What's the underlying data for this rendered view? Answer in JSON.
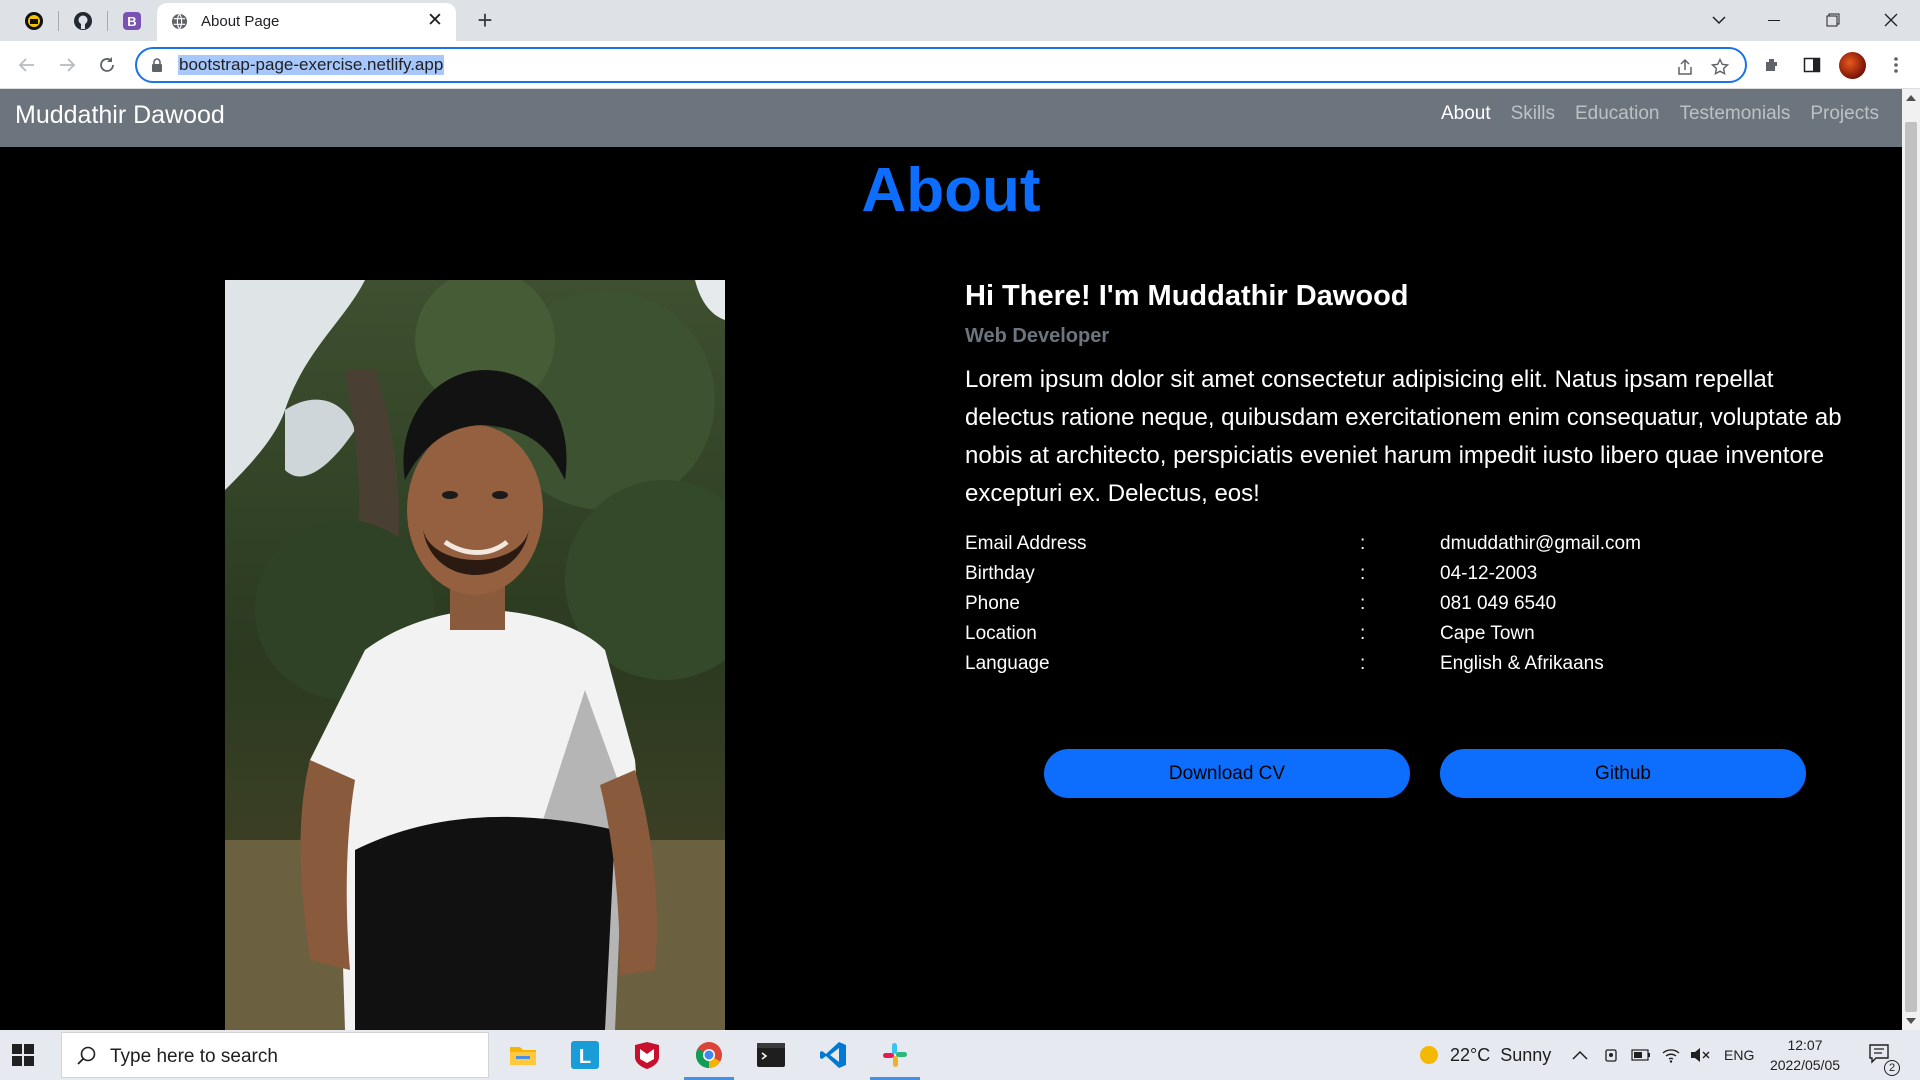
{
  "browser": {
    "tab_title": "About Page",
    "url": "bootstrap-page-exercise.netlify.app",
    "pinned_tabs": [
      "pinned-tab-icon",
      "github-icon",
      "bootstrap-icon"
    ]
  },
  "navbar": {
    "brand": "Muddathir Dawood",
    "links": [
      "About",
      "Skills",
      "Education",
      "Testemonials",
      "Projects"
    ],
    "active": "About"
  },
  "page": {
    "title": "About",
    "heading": "Hi There! I'm Muddathir Dawood",
    "role": "Web Developer",
    "bio": "Lorem ipsum dolor sit amet consectetur adipisicing elit. Natus ipsam repellat delectus ratione neque, quibusdam exercitationem enim consequatur, voluptate ab nobis at architecto, perspiciatis eveniet harum impedit iusto libero quae inventore excepturi ex. Delectus, eos!",
    "details": [
      {
        "label": "Email Address",
        "sep": ":",
        "value": "dmuddathir@gmail.com"
      },
      {
        "label": "Birthday",
        "sep": ":",
        "value": "04-12-2003"
      },
      {
        "label": "Phone",
        "sep": ":",
        "value": "081 049 6540"
      },
      {
        "label": "Location",
        "sep": ":",
        "value": "Cape Town"
      },
      {
        "label": "Language",
        "sep": ":",
        "value": "English & Afrikaans"
      }
    ],
    "buttons": {
      "download": "Download CV",
      "github": "Github"
    }
  },
  "taskbar": {
    "search_placeholder": "Type here to search",
    "weather": "22°C  Sunny",
    "language": "ENG",
    "time": "12:07",
    "date": "2022/05/05",
    "notifications": "2"
  },
  "colors": {
    "primary": "#0d6efd",
    "navbar": "#6c757d",
    "background": "#000000"
  }
}
